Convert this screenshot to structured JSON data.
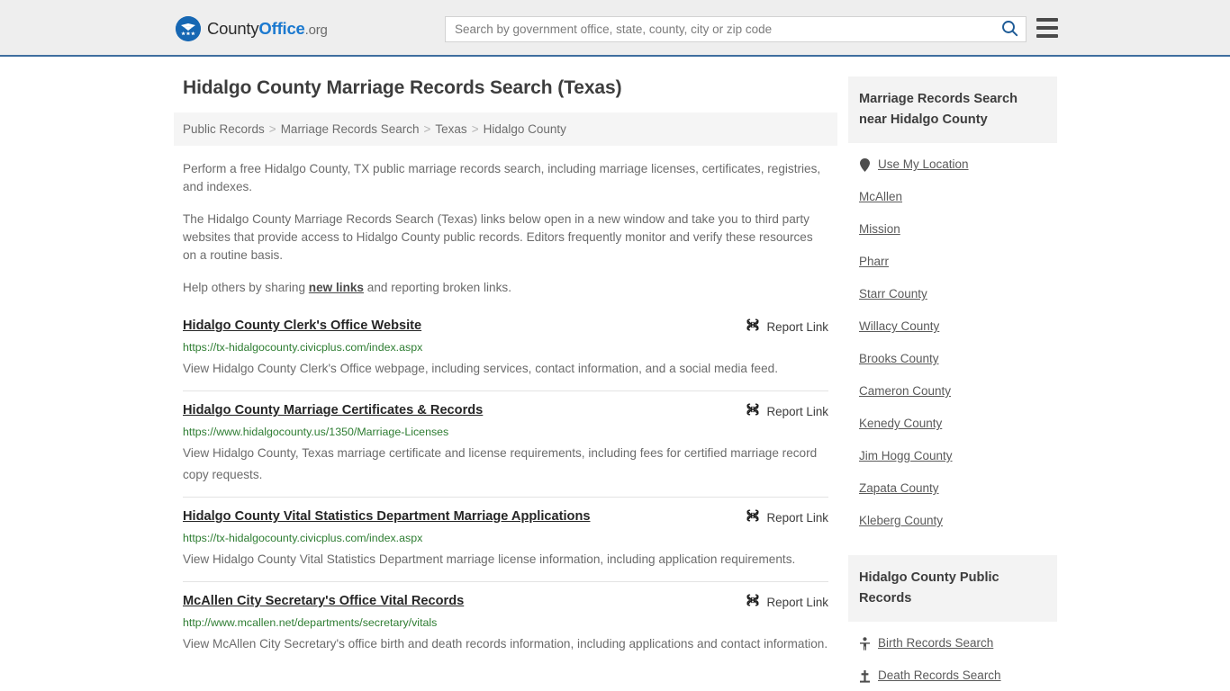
{
  "header": {
    "logo": {
      "icon": "eagle-shield-logo-icon",
      "part1": "County",
      "part2": "Office",
      "part3": ".org"
    },
    "search": {
      "placeholder": "Search by government office, state, county, city or zip code",
      "value": "",
      "search_icon": "search-icon"
    },
    "menu_icon": "hamburger-menu-icon",
    "accent_color": "#3e6e9e"
  },
  "page": {
    "title": "Hidalgo County Marriage Records Search (Texas)",
    "breadcrumb": [
      {
        "label": "Public Records"
      },
      {
        "label": "Marriage Records Search"
      },
      {
        "label": "Texas"
      },
      {
        "label": "Hidalgo County"
      }
    ],
    "breadcrumb_separator": ">",
    "intro": [
      {
        "text": "Perform a free Hidalgo County, TX public marriage records search, including marriage licenses, certificates, registries, and indexes."
      },
      {
        "text": "The Hidalgo County Marriage Records Search (Texas) links below open in a new window and take you to third party websites that provide access to Hidalgo County public records. Editors frequently monitor and verify these resources on a routine basis."
      }
    ],
    "help_line": {
      "before": "Help others by sharing ",
      "link": "new links",
      "after": " and reporting broken links."
    }
  },
  "results": {
    "report_label": "Report Link",
    "report_icon": "broken-link-icon",
    "items": [
      {
        "title": "Hidalgo County Clerk's Office Website",
        "url": "https://tx-hidalgocounty.civicplus.com/index.aspx",
        "description": "View Hidalgo County Clerk's Office webpage, including services, contact information, and a social media feed."
      },
      {
        "title": "Hidalgo County Marriage Certificates & Records",
        "url": "https://www.hidalgocounty.us/1350/Marriage-Licenses",
        "description": "View Hidalgo County, Texas marriage certificate and license requirements, including fees for certified marriage record copy requests."
      },
      {
        "title": "Hidalgo County Vital Statistics Department Marriage Applications",
        "url": "https://tx-hidalgocounty.civicplus.com/index.aspx",
        "description": "View Hidalgo County Vital Statistics Department marriage license information, including application requirements."
      },
      {
        "title": "McAllen City Secretary's Office Vital Records",
        "url": "http://www.mcallen.net/departments/secretary/vitals",
        "description": "View McAllen City Secretary's office birth and death records information, including applications and contact information."
      }
    ]
  },
  "sidebar": {
    "nearby": {
      "heading": "Marriage Records Search near Hidalgo County",
      "items": [
        {
          "label": "Use My Location",
          "icon": "map-pin-icon"
        },
        {
          "label": "McAllen",
          "icon": ""
        },
        {
          "label": "Mission",
          "icon": ""
        },
        {
          "label": "Pharr",
          "icon": ""
        },
        {
          "label": "Starr County",
          "icon": ""
        },
        {
          "label": "Willacy County",
          "icon": ""
        },
        {
          "label": "Brooks County",
          "icon": ""
        },
        {
          "label": "Cameron County",
          "icon": ""
        },
        {
          "label": "Kenedy County",
          "icon": ""
        },
        {
          "label": "Jim Hogg County",
          "icon": ""
        },
        {
          "label": "Zapata County",
          "icon": ""
        },
        {
          "label": "Kleberg County",
          "icon": ""
        }
      ]
    },
    "public_records": {
      "heading": "Hidalgo County Public Records",
      "items": [
        {
          "label": "Birth Records Search",
          "icon": "baby-icon"
        },
        {
          "label": "Death Records Search",
          "icon": "grave-cross-icon"
        }
      ]
    }
  }
}
